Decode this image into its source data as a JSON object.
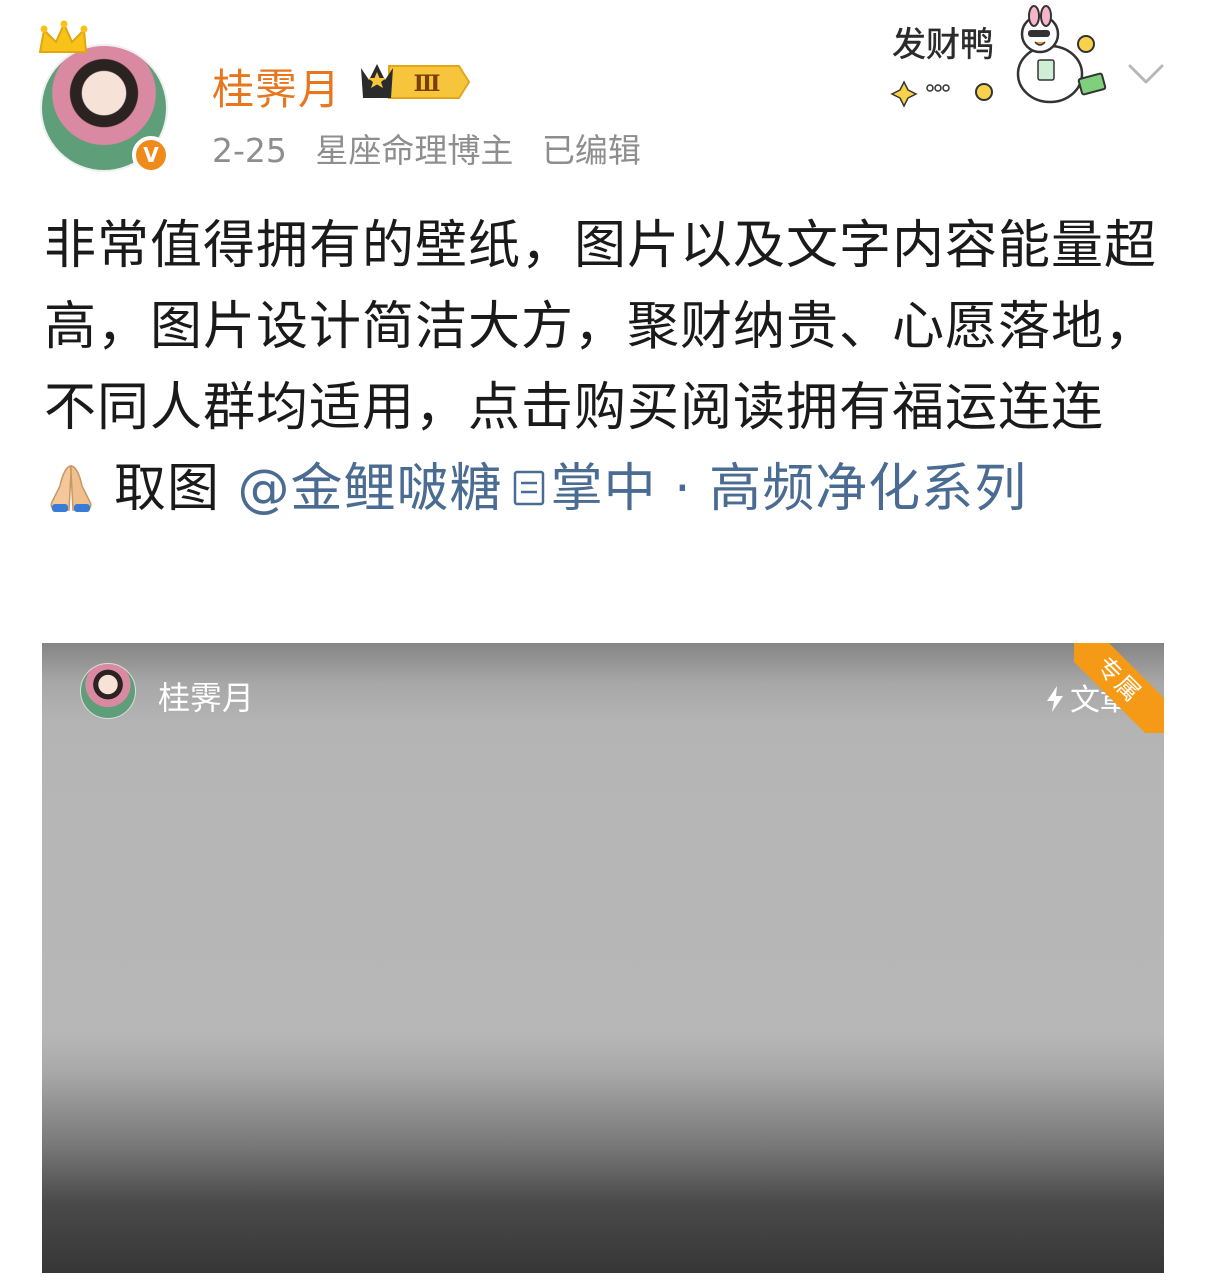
{
  "post": {
    "username": "桂霁月",
    "vip_level": "Ⅲ",
    "date": "2-25",
    "bio": "星座命理博主",
    "edited": "已编辑",
    "verified_mark": "V",
    "sticker_text": "发财鸭",
    "text_main": "非常值得拥有的壁纸，图片以及文字内容能量超高，图片设计简洁大方，聚财纳贵、心愿落地，不同人群均适用，点击购买阅读拥有福运连连",
    "text_after_emoji": "取图",
    "mention": "@金鲤啵糖",
    "topic": "掌中 · 高频净化系列",
    "icons": {
      "crown": "crown-icon",
      "verified": "verified-badge-icon",
      "emoji": "folded-hands-emoji",
      "topic": "document-icon",
      "chevron": "chevron-down-icon",
      "bolt": "lightning-icon"
    },
    "colors": {
      "username": "#e8761e",
      "link": "#4a6b92",
      "meta": "#8e8e8e",
      "ribbon": "#f49a16"
    }
  },
  "card": {
    "author": "桂霁月",
    "type_label": "文章",
    "ribbon_label": "专属"
  }
}
